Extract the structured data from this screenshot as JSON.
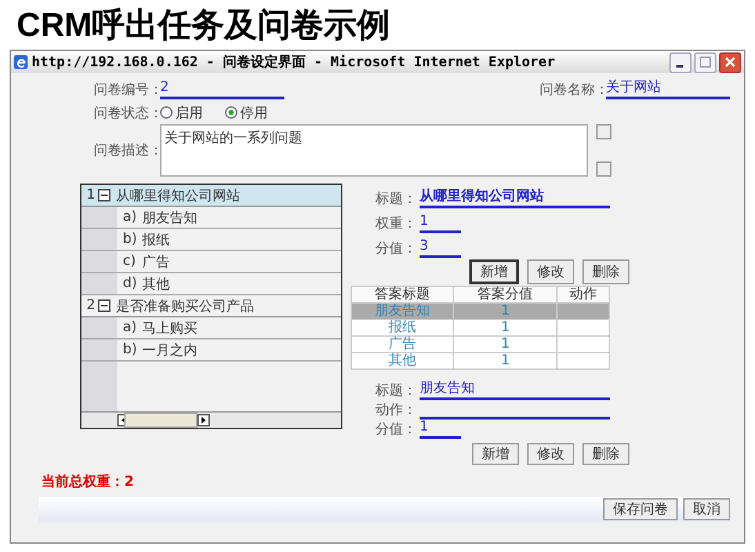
{
  "slide_title": "CRM呼出任务及问卷示例",
  "window": {
    "title": "http://192.168.0.162 - 问卷设定界面 - Microsoft Internet Explorer"
  },
  "form": {
    "number_label": "问卷编号：",
    "number_value": "2",
    "name_label": "问卷名称：",
    "name_value": "关于网站",
    "status_label": "问卷状态：",
    "status_options": [
      {
        "label": "启用",
        "selected": false
      },
      {
        "label": "停用",
        "selected": true
      }
    ],
    "description_label": "问卷描述：",
    "description_value": "关于网站的一系列问题"
  },
  "question_tree": [
    {
      "number": "1",
      "expanded": true,
      "text": "从哪里得知公司网站",
      "selected": true,
      "children": [
        {
          "letter": "a)",
          "text": "朋友告知"
        },
        {
          "letter": "b)",
          "text": "报纸"
        },
        {
          "letter": "c)",
          "text": "广告"
        },
        {
          "letter": "d)",
          "text": "其他"
        }
      ]
    },
    {
      "number": "2",
      "expanded": true,
      "text": "是否准备购买公司产品",
      "selected": false,
      "children": [
        {
          "letter": "a)",
          "text": "马上购买"
        },
        {
          "letter": "b)",
          "text": "一月之内"
        }
      ]
    }
  ],
  "question_detail": {
    "title_label": "标题：",
    "title_value": "从哪里得知公司网站",
    "weight_label": "权重：",
    "weight_value": "1",
    "score_label": "分值：",
    "score_value": "3",
    "buttons": [
      "新增",
      "修改",
      "删除"
    ]
  },
  "answer_table": {
    "columns": [
      "答案标题",
      "答案分值",
      "动作"
    ],
    "rows": [
      {
        "title": "朋友告知",
        "score": "1",
        "selected": true
      },
      {
        "title": "报纸",
        "score": "1",
        "selected": false
      },
      {
        "title": "广告",
        "score": "1",
        "selected": false
      },
      {
        "title": "其他",
        "score": "1",
        "selected": false
      }
    ]
  },
  "answer_detail": {
    "title_label": "标题：",
    "title_value": "朋友告知",
    "action_label": "动作：",
    "score_label": "分值：",
    "score_value": "1",
    "buttons": [
      "新增",
      "修改",
      "删除"
    ]
  },
  "total_weight": "当前总权重：2",
  "footer_buttons": [
    "保存问卷",
    "取消"
  ]
}
